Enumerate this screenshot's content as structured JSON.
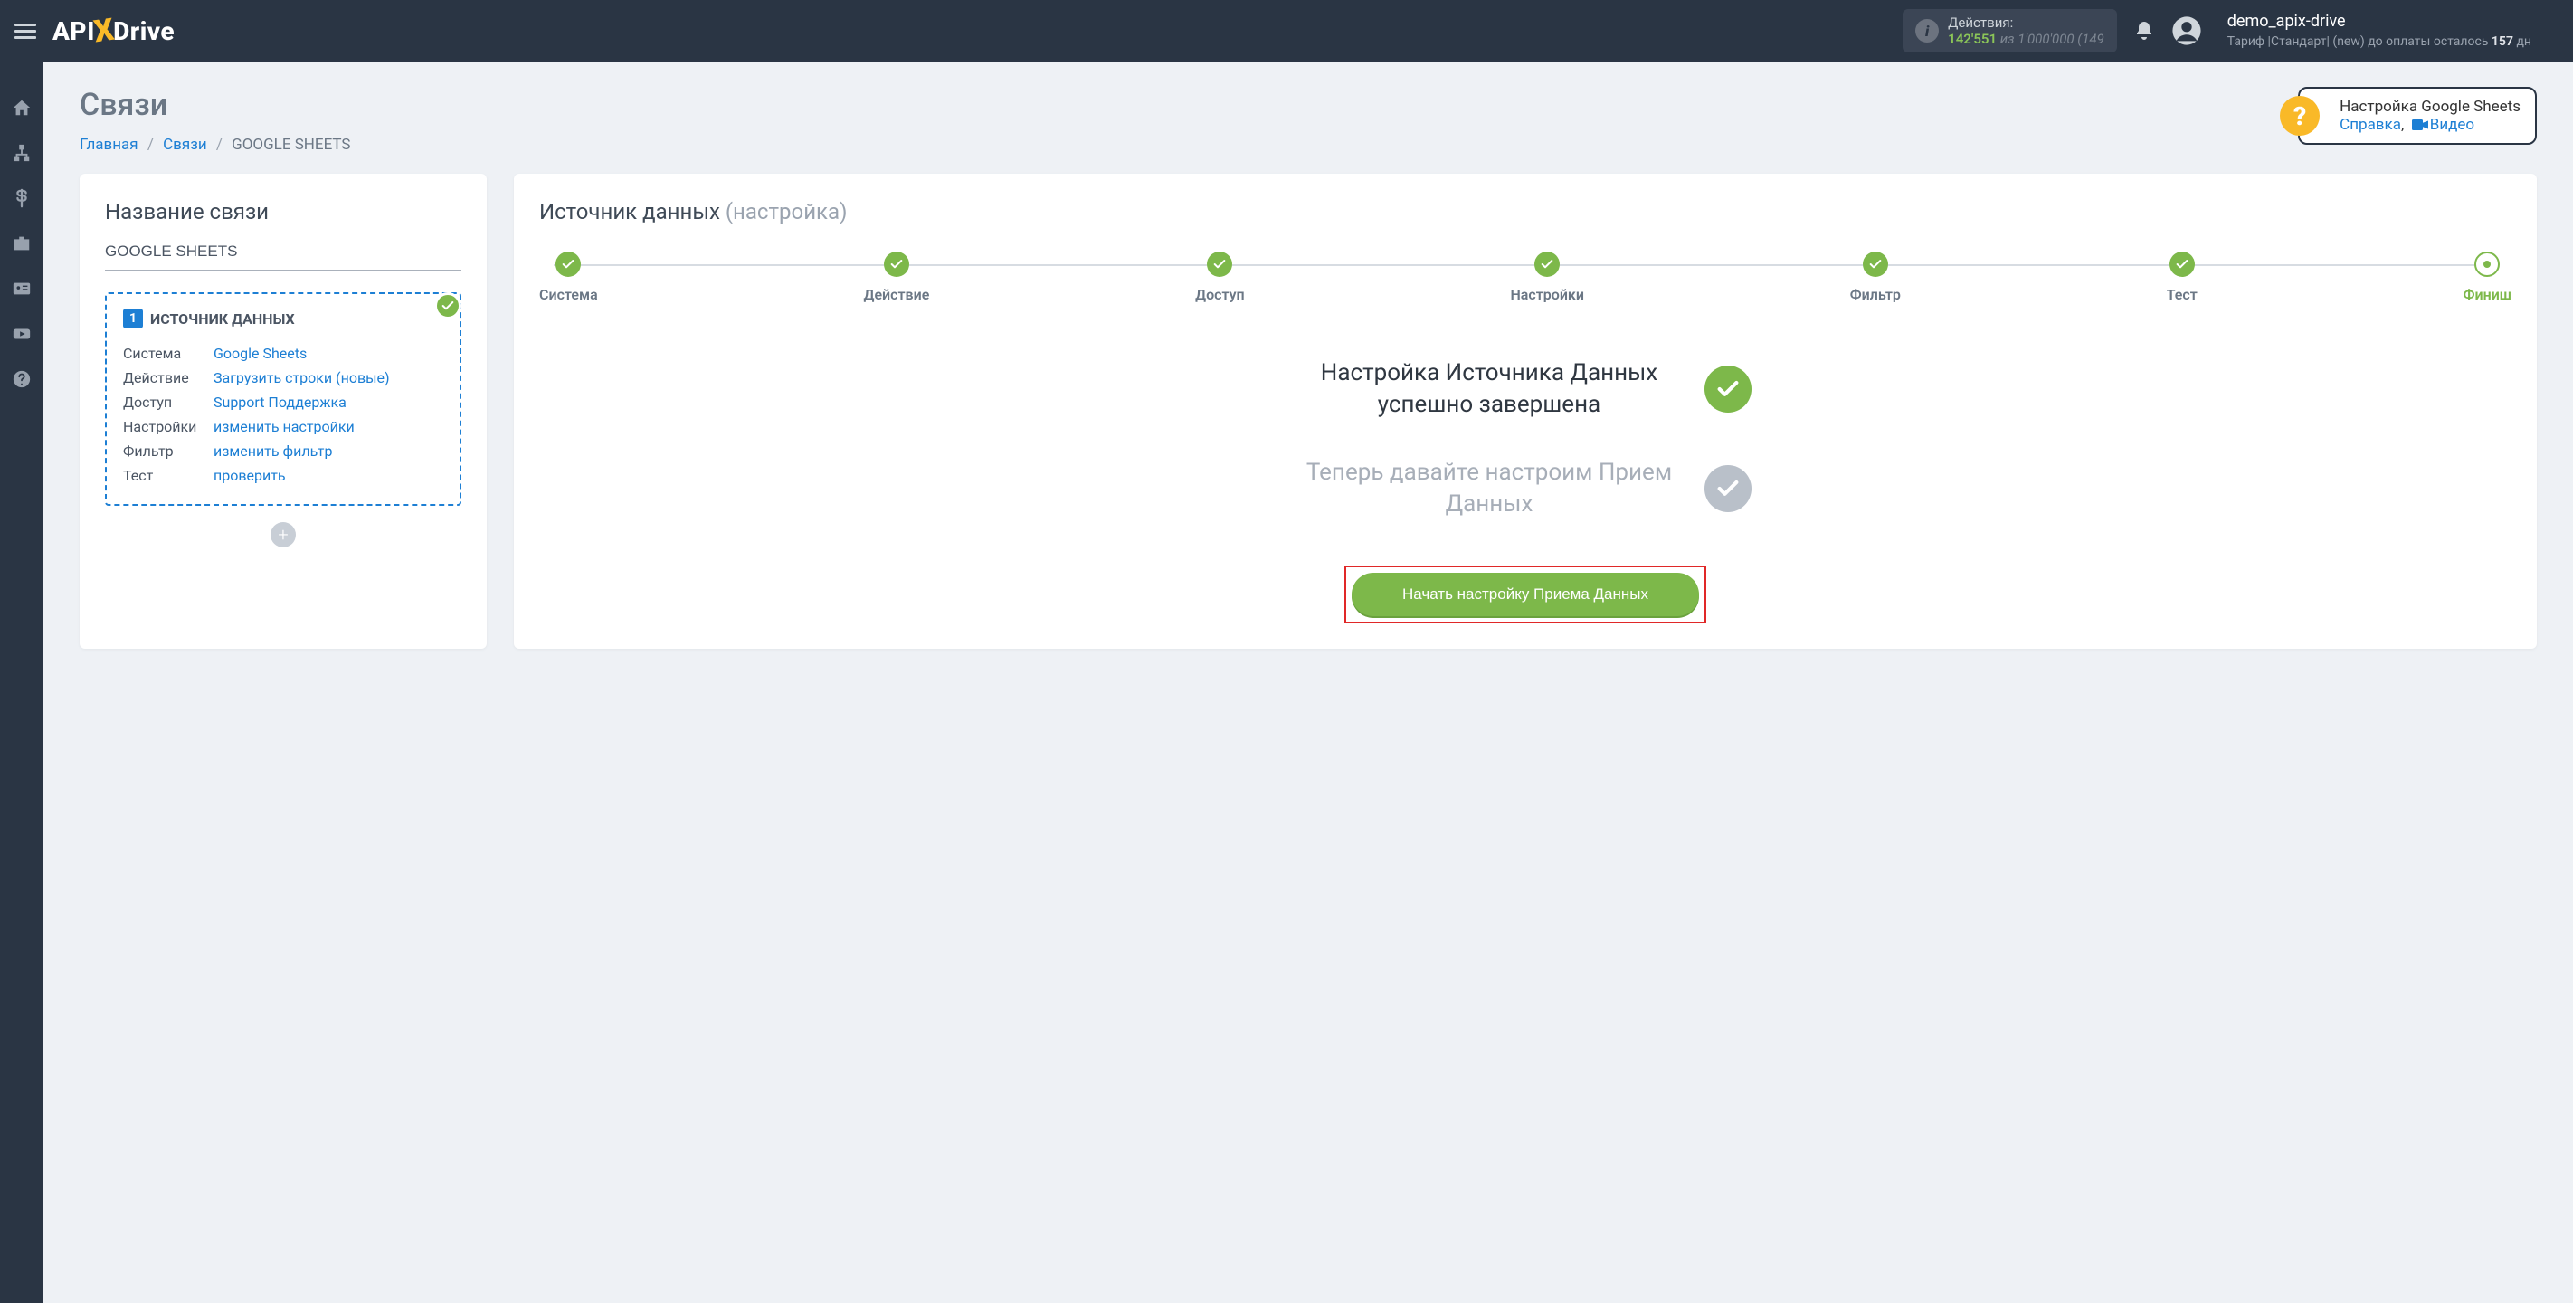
{
  "header": {
    "logo_parts": {
      "api": "API",
      "x": "X",
      "drive": "Drive"
    },
    "actions": {
      "label": "Действия:",
      "value": "142'551",
      "of_word": "из",
      "total": "1'000'000",
      "trail": "(149"
    },
    "user": {
      "name": "demo_apix-drive",
      "tariff_prefix": "Тариф |Стандарт| (new) до оплаты осталось ",
      "days": "157",
      "tariff_suffix": " дн"
    }
  },
  "sidebar_icons": [
    "home",
    "sitemap",
    "dollar",
    "briefcase",
    "id-card",
    "youtube",
    "question"
  ],
  "page_title": "Связи",
  "breadcrumb": {
    "home": "Главная",
    "links": "Связи",
    "current": "GOOGLE SHEETS"
  },
  "help": {
    "title": "Настройка Google Sheets",
    "ref": "Справка",
    "video": "Видео"
  },
  "left_card": {
    "title": "Название связи",
    "conn_name": "GOOGLE SHEETS",
    "source": {
      "num": "1",
      "header": "ИСТОЧНИК ДАННЫХ",
      "rows": [
        {
          "k": "Система",
          "v": "Google Sheets"
        },
        {
          "k": "Действие",
          "v": "Загрузить строки (новые)"
        },
        {
          "k": "Доступ",
          "v": "Support Поддержка"
        },
        {
          "k": "Настройки",
          "v": "изменить настройки"
        },
        {
          "k": "Фильтр",
          "v": "изменить фильтр"
        },
        {
          "k": "Тест",
          "v": "проверить"
        }
      ]
    }
  },
  "right_card": {
    "title": "Источник данных",
    "subtitle": "(настройка)",
    "steps": [
      "Система",
      "Действие",
      "Доступ",
      "Настройки",
      "Фильтр",
      "Тест",
      "Финиш"
    ],
    "success": "Настройка Источника Данных успешно завершена",
    "pending": "Теперь давайте настроим Прием Данных",
    "cta": "Начать настройку Приема Данных"
  }
}
